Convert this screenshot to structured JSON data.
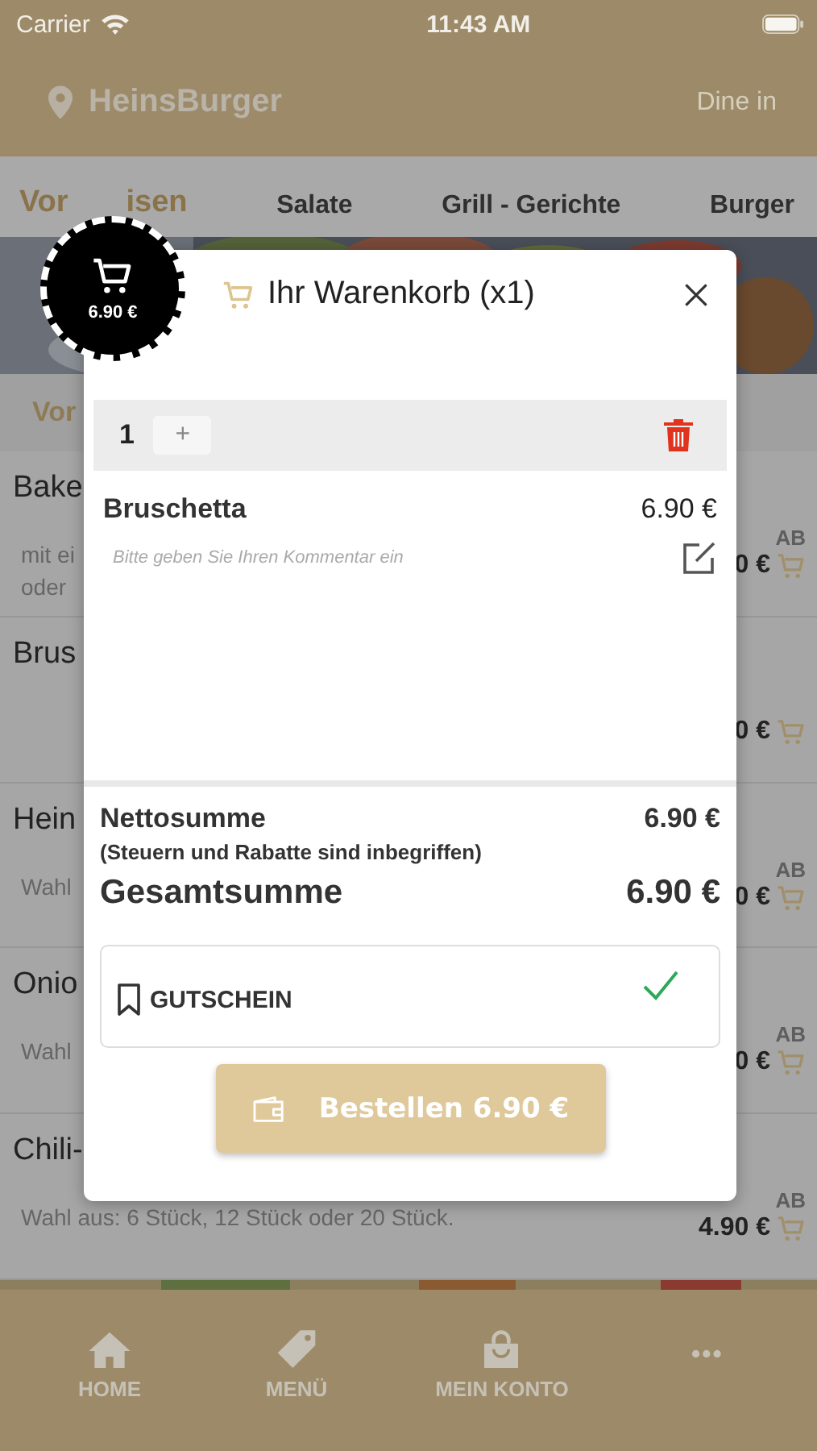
{
  "status_bar": {
    "carrier": "Carrier",
    "time": "11:43 AM"
  },
  "header": {
    "location": "HeinsBurger",
    "mode": "Dine in"
  },
  "category_tabs": [
    {
      "label": "Vor",
      "label_end": "isen",
      "selected": true
    },
    {
      "label": "Salate",
      "selected": false
    },
    {
      "label": "Grill - Gerichte",
      "selected": false
    },
    {
      "label": "Burger",
      "selected": false
    }
  ],
  "section_title": "Vor",
  "menu_items": [
    {
      "name": "Bake",
      "description_lines": [
        "mit ei",
        "oder"
      ],
      "price_prefix": "AB",
      "price": "0 €"
    },
    {
      "name": "Brus",
      "price": "0 €"
    },
    {
      "name": "Hein",
      "description_lines": [
        "Wahl"
      ],
      "price_prefix": "AB",
      "price": "0 €"
    },
    {
      "name": "Onio",
      "description_lines": [
        "Wahl"
      ],
      "price_prefix": "AB",
      "price": "0 €"
    },
    {
      "name": "Chili-",
      "description_lines": [
        "Wahl aus: 6 Stück, 12 Stück oder 20 Stück."
      ],
      "price_prefix": "AB",
      "price": "4.90 €"
    }
  ],
  "cart_badge": {
    "total": "6.90 €"
  },
  "cart_modal": {
    "title": "Ihr Warenkorb (x1)",
    "items": [
      {
        "quantity": "1",
        "plus": "+",
        "name": "Bruschetta",
        "price": "6.90 €",
        "comment_placeholder": "Bitte geben Sie Ihren Kommentar ein"
      }
    ],
    "net_label": "Nettosumme",
    "net_note": "(Steuern und Rabatte sind inbegriffen)",
    "net_value": "6.90 €",
    "total_label": "Gesamtsumme",
    "total_value": "6.90 €",
    "voucher_label": "GUTSCHEIN",
    "voucher_applied": true,
    "order_button": "Bestellen 6.90 €"
  },
  "bottom_nav": [
    {
      "label": "HOME"
    },
    {
      "label": "MENÜ"
    },
    {
      "label": "MEIN KONTO"
    },
    {
      "label": "•••"
    }
  ]
}
